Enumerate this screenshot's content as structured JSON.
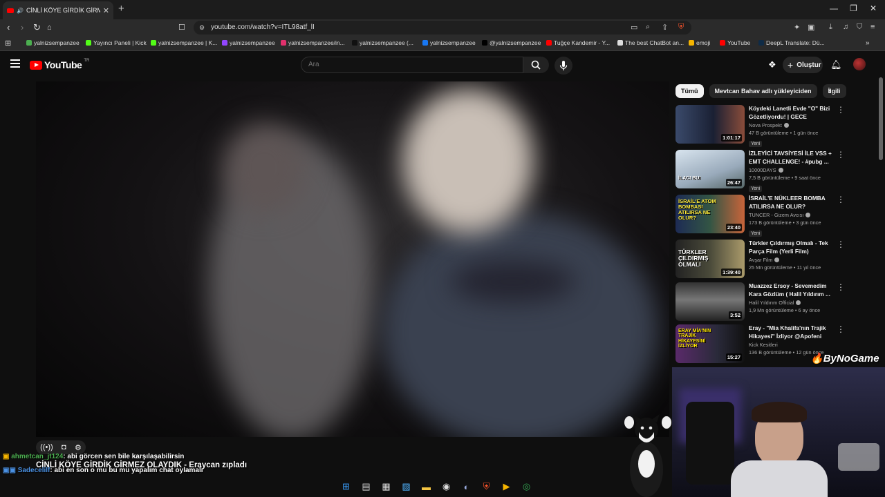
{
  "browser": {
    "tab_title": "CİNLİ KÖYE GİRDİK GİRMEZ O",
    "url": "youtube.com/watch?v=ITL98atf_lI",
    "bookmarks": [
      {
        "label": "yalnizsempanzee",
        "color": "#4caf50"
      },
      {
        "label": "Yayıncı Paneli | Kick",
        "color": "#53fc18"
      },
      {
        "label": "yalnizsempanzee | K...",
        "color": "#53fc18"
      },
      {
        "label": "yalnizsempanzee",
        "color": "#9146ff"
      },
      {
        "label": "yalnizsempanzee/in...",
        "color": "#e1306c"
      },
      {
        "label": "yalnizsempanzee (...",
        "color": "#111111"
      },
      {
        "label": "yalnizsempanzee",
        "color": "#1877f2"
      },
      {
        "label": "@yalnizsempanzee",
        "color": "#000000"
      },
      {
        "label": "Tuğçe Kandemir - Y...",
        "color": "#ff0000"
      },
      {
        "label": "The best ChatBot an...",
        "color": "#dddddd"
      },
      {
        "label": "emoji",
        "color": "#f5b400"
      },
      {
        "label": "YouTube",
        "color": "#ff0000"
      },
      {
        "label": "DeepL Translate: Dü...",
        "color": "#0f2b46"
      }
    ]
  },
  "youtube": {
    "logo_text": "YouTube",
    "region": "TR",
    "search_placeholder": "Ara",
    "create_label": "Oluştur",
    "chips": [
      "Tümü",
      "Mevtcan Bahav adlı yükleyiciden",
      "İlgili"
    ],
    "recommendations": [
      {
        "title": "Köydeki Lanetli Evde \"O\" Bizi Gözetliyordu! | GECE GÖZCÜS...",
        "channel": "Nova Prospekt",
        "verified": true,
        "meta": "47 B görüntüleme • 1 gün önce",
        "badge": "Yeni",
        "duration": "1:01:17",
        "overlay": ""
      },
      {
        "title": "İZLEYİCİ TAVSİYESİ İLE VSS + EMT CHALLENGE! - #pubg ...",
        "channel": "10000DAYS",
        "verified": true,
        "meta": "7,5 B görüntüleme • 9 saat önce",
        "badge": "Yeni",
        "duration": "26:47",
        "overlay": "İLACI BU!"
      },
      {
        "title": "İSRAİL'E NÜKLEER BOMBA ATILIRSA NE OLUR? ÜRPERTE...",
        "channel": "TUNCER - Gizem Avcısı",
        "verified": true,
        "meta": "173 B görüntüleme • 3 gün önce",
        "badge": "Yeni",
        "duration": "23:40",
        "overlay": "İSRAİL'E ATOM BOMBASI ATILIRSA NE OLUR?"
      },
      {
        "title": "Türkler Çıldırmış Olmalı - Tek Parça Film (Yerli Film)",
        "channel": "Avşar Film",
        "verified": true,
        "meta": "25 Mn görüntüleme • 11 yıl önce",
        "badge": "",
        "duration": "1:39:40",
        "overlay": "TÜRKLER ÇILDIRMIŞ OLMALI"
      },
      {
        "title": "Muazzez Ersoy - Sevemedim Kara Gözlüm ( Halil Yıldırım ...",
        "channel": "Halil Yıldırım Official",
        "verified": true,
        "meta": "1,9 Mn görüntüleme • 6 ay önce",
        "badge": "",
        "duration": "3:52",
        "overlay": ""
      },
      {
        "title": "Eray - \"Mia Khalifa'nın Trajik Hikayesi\" İzliyor @Apofeni",
        "channel": "Kick Kesitleri",
        "verified": false,
        "meta": "136 B görüntüleme • 12 gün önce",
        "badge": "",
        "duration": "15:27",
        "overlay": "ERAY MİA'NIN TRAJİK HİKAYESİNİ İZLİYOR"
      }
    ]
  },
  "stream_overlay": {
    "chat": [
      {
        "user": "ahmetcan_jt124",
        "message": ": abi görcen sen bile karşılaşabilirsin",
        "user_color": "#4caf50"
      },
      {
        "user": "Sadecelilf",
        "message": ": abi en son o mu bu mu yapalım chat oylamalı",
        "user_color": "#4a90e2"
      }
    ],
    "video_title": "CİNLİ KÖYE GİRDİK GİRMEZ OLAYDIK - Eraycan zıpladı",
    "brand": "ByNoGame"
  }
}
